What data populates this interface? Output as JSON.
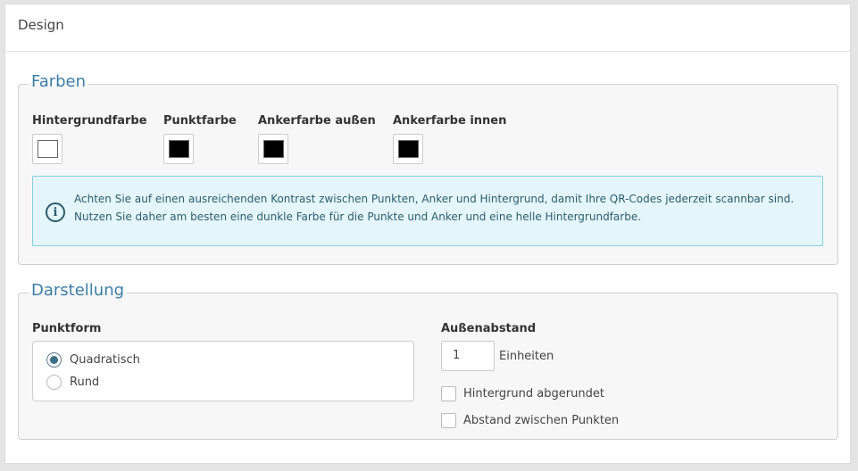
{
  "panel": {
    "title": "Design"
  },
  "farben": {
    "legend": "Farben",
    "fields": [
      {
        "label": "Hintergrundfarbe",
        "color": "#ffffff"
      },
      {
        "label": "Punktfarbe",
        "color": "#000000"
      },
      {
        "label": "Ankerfarbe außen",
        "color": "#000000"
      },
      {
        "label": "Ankerfarbe innen",
        "color": "#000000"
      }
    ],
    "info": {
      "icon": "info-circle-icon",
      "line1": "Achten Sie auf einen ausreichenden Kontrast zwischen Punkten, Anker und Hintergrund, damit Ihre QR-Codes jederzeit scannbar sind.",
      "line2": "Nutzen Sie daher am besten eine dunkle Farbe für die Punkte und Anker und eine helle Hintergrundfarbe."
    }
  },
  "darstellung": {
    "legend": "Darstellung",
    "punktform": {
      "label": "Punktform",
      "options": [
        {
          "label": "Quadratisch",
          "checked": true
        },
        {
          "label": "Rund",
          "checked": false
        }
      ]
    },
    "aussenabstand": {
      "label": "Außenabstand",
      "value": "1",
      "unit": "Einheiten"
    },
    "checkboxes": [
      {
        "label": "Hintergrund abgerundet",
        "checked": false
      },
      {
        "label": "Abstand zwischen Punkten",
        "checked": false
      }
    ]
  },
  "colors": {
    "accent": "#3c7ea8",
    "info_bg": "#e4f6fb",
    "info_border": "#85cfdc"
  }
}
